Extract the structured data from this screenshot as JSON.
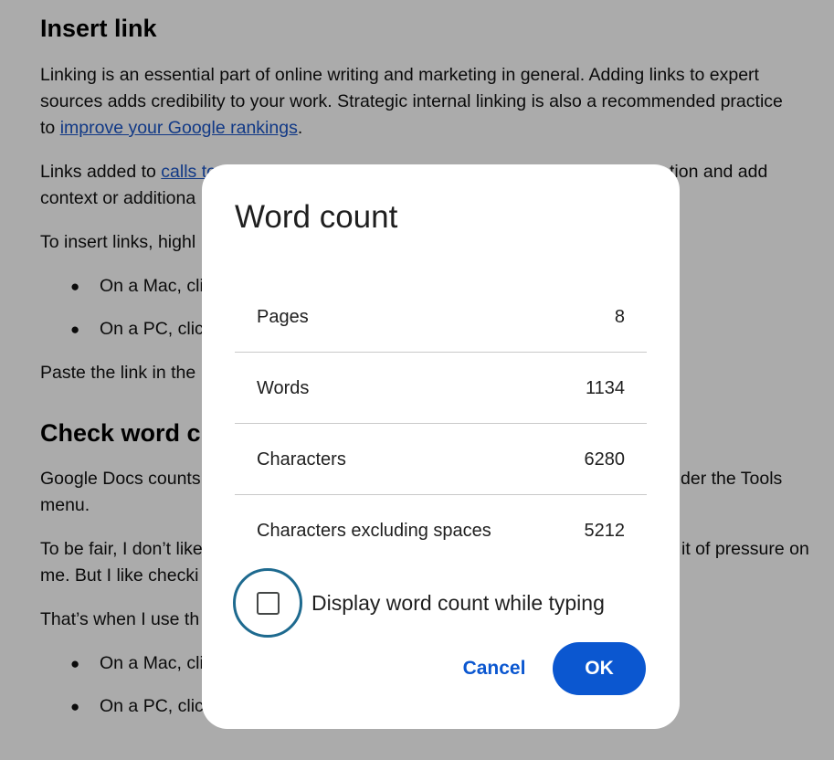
{
  "background_doc": {
    "heading1": "Insert link",
    "p1_line1": "Linking is an essential part of online writing and marketing in general. Adding links to expert",
    "p1_line2": "sources adds credibility to your work. Strategic internal linking is also a recommended practice",
    "p1_line3_prefix": "to ",
    "p1_link": "improve your Google rankings",
    "p1_line3_suffix": ".",
    "p2_line1_prefix": "Links added to ",
    "p2_link": "calls to",
    "p2_line1_right": "tion and add",
    "p2_line2": "context or additiona",
    "p3_line1": "To insert links, highl",
    "bullet1": "On a Mac, cli",
    "bullet2": "On a PC, click",
    "p4_line1": "Paste the link in the",
    "heading2": "Check word c",
    "p5_line1": "Google Docs counts",
    "p5_line1_right": "der the Tools",
    "p5_line2": "menu.",
    "p6_line1": "To be fair, I don’t like",
    "p6_line1_right": "it of pressure on",
    "p6_line2": "me. But I like checki",
    "p7_line1": "That’s when I use th",
    "bullet3": "On a Mac, cli",
    "bullet4": "On a PC, click",
    "bullet_glyph": "●"
  },
  "dialog": {
    "title": "Word count",
    "stats": [
      {
        "label": "Pages",
        "value": "8"
      },
      {
        "label": "Words",
        "value": "1134"
      },
      {
        "label": "Characters",
        "value": "6280"
      },
      {
        "label": "Characters excluding spaces",
        "value": "5212"
      }
    ],
    "checkbox_label": "Display word count while typing",
    "checkbox_checked": false,
    "cancel_label": "Cancel",
    "ok_label": "OK"
  },
  "colors": {
    "accent": "#0b57d0",
    "link": "#1a55c8",
    "focus_ring": "#1e6a8f",
    "scrim": "rgba(0,0,0,0.33)"
  }
}
